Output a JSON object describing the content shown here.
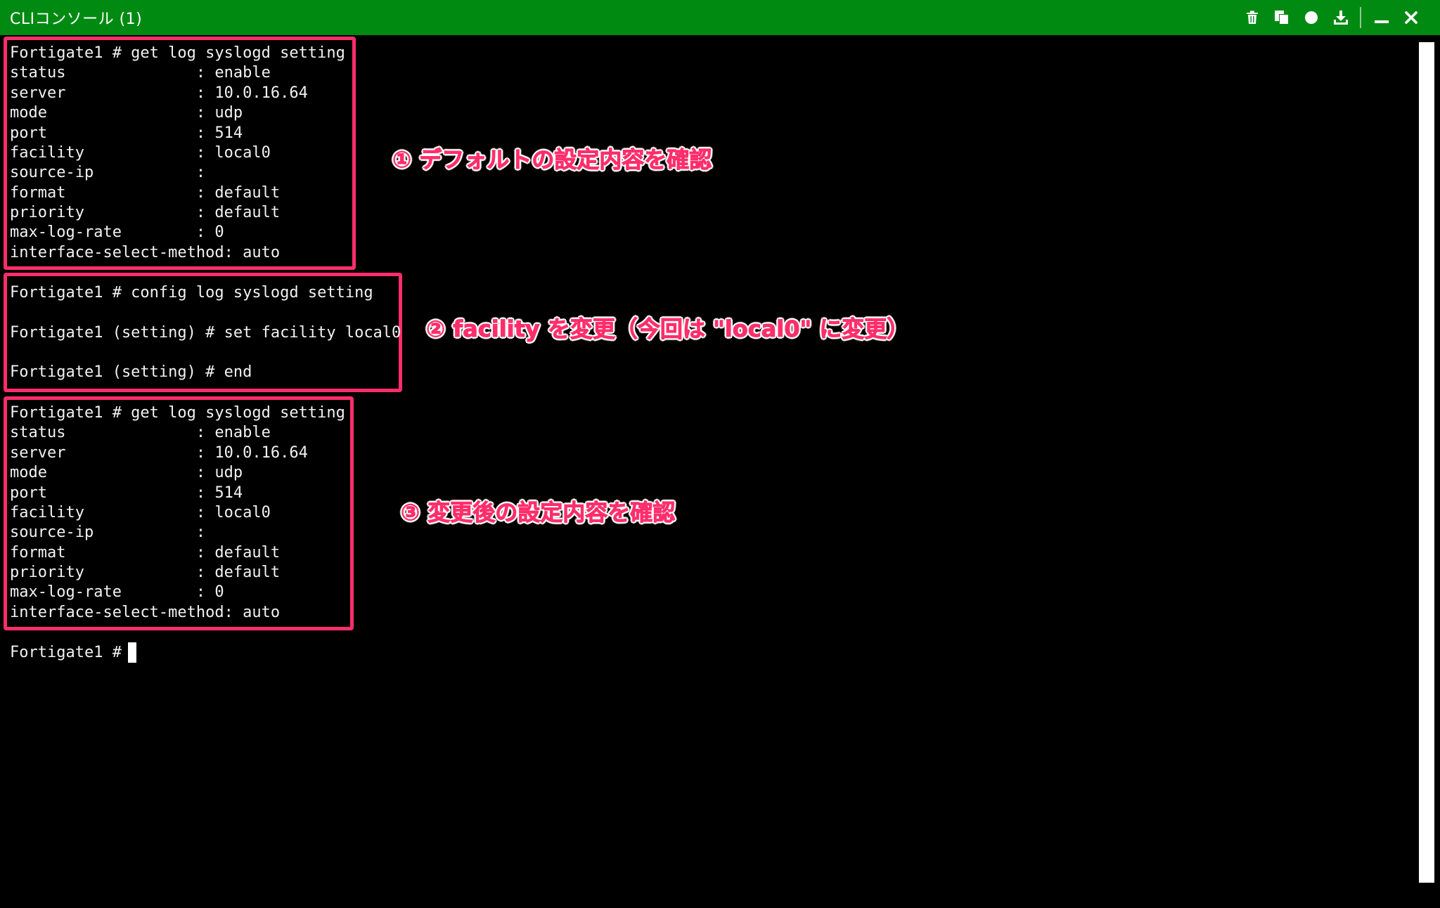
{
  "window": {
    "title": "CLIコンソール (1)"
  },
  "toolbar": {
    "icons": [
      "trash-icon",
      "copy-icon",
      "record-icon",
      "download-icon",
      "minimize-icon",
      "close-icon"
    ]
  },
  "block1": {
    "lines": [
      "Fortigate1 # get log syslogd setting",
      "status              : enable",
      "server              : 10.0.16.64",
      "mode                : udp",
      "port                : 514",
      "facility            : local0",
      "source-ip           :",
      "format              : default",
      "priority            : default",
      "max-log-rate        : 0",
      "interface-select-method: auto"
    ]
  },
  "block2": {
    "lines": [
      "Fortigate1 # config log syslogd setting",
      "",
      "Fortigate1 (setting) # set facility local0",
      "",
      "Fortigate1 (setting) # end"
    ]
  },
  "block3": {
    "lines": [
      "Fortigate1 # get log syslogd setting",
      "status              : enable",
      "server              : 10.0.16.64",
      "mode                : udp",
      "port                : 514",
      "facility            : local0",
      "source-ip           :",
      "format              : default",
      "priority            : default",
      "max-log-rate        : 0",
      "interface-select-method: auto"
    ]
  },
  "prompt": "Fortigate1 #",
  "callouts": {
    "c1": "① デフォルトの設定内容を確認",
    "c2": "② facility を変更（今回は \"local0\" に変更）",
    "c3": "③ 変更後の設定内容を確認"
  },
  "colors": {
    "titlebar": "#008a12",
    "highlight": "#ff2e6b",
    "terminal_bg": "#000000",
    "terminal_text": "#f2f2f2"
  }
}
